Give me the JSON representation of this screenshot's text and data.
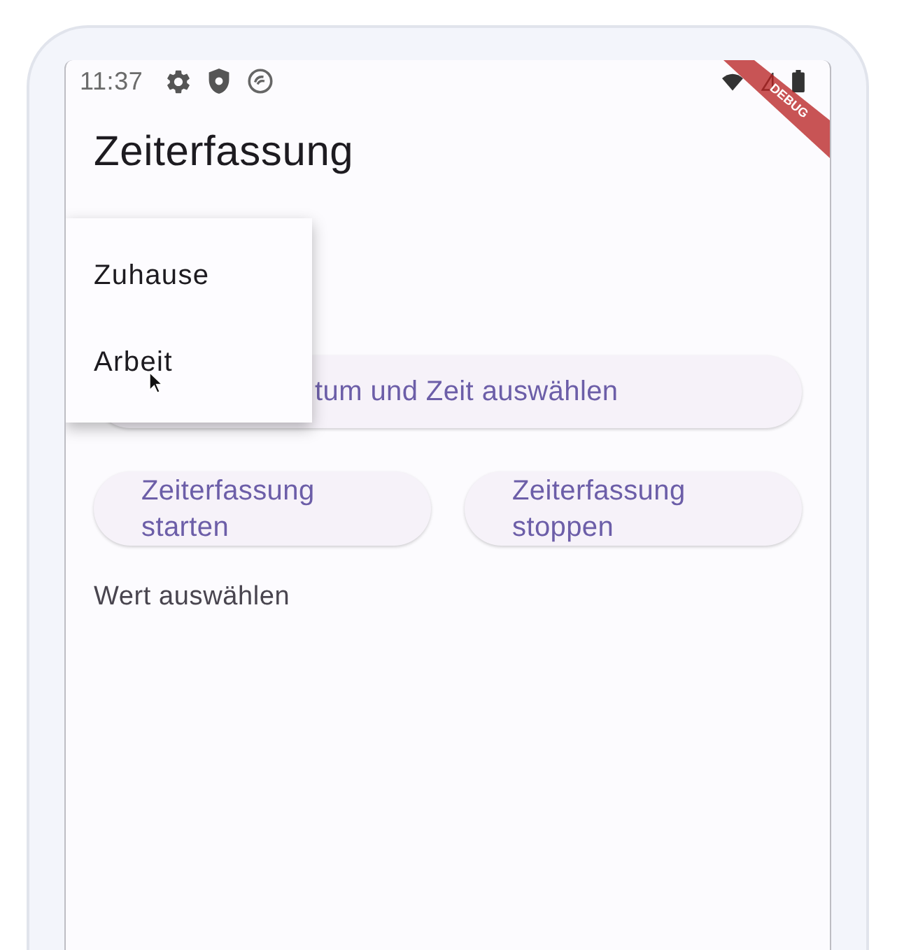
{
  "status_bar": {
    "time": "11:37"
  },
  "debug_banner": {
    "label": "DEBUG"
  },
  "app_bar": {
    "title": "Zeiterfassung"
  },
  "menu": {
    "items": [
      {
        "label": "Zuhause",
        "selected": false
      },
      {
        "label": "Arbeit",
        "selected": false
      }
    ]
  },
  "date_time_button": {
    "label": "tum und Zeit auswählen"
  },
  "buttons": [
    {
      "label": "Zeiterfassung starten"
    },
    {
      "label": "Zeiterfassung stoppen"
    }
  ],
  "dropdown": {
    "placeholder": "Wert auswählen"
  }
}
